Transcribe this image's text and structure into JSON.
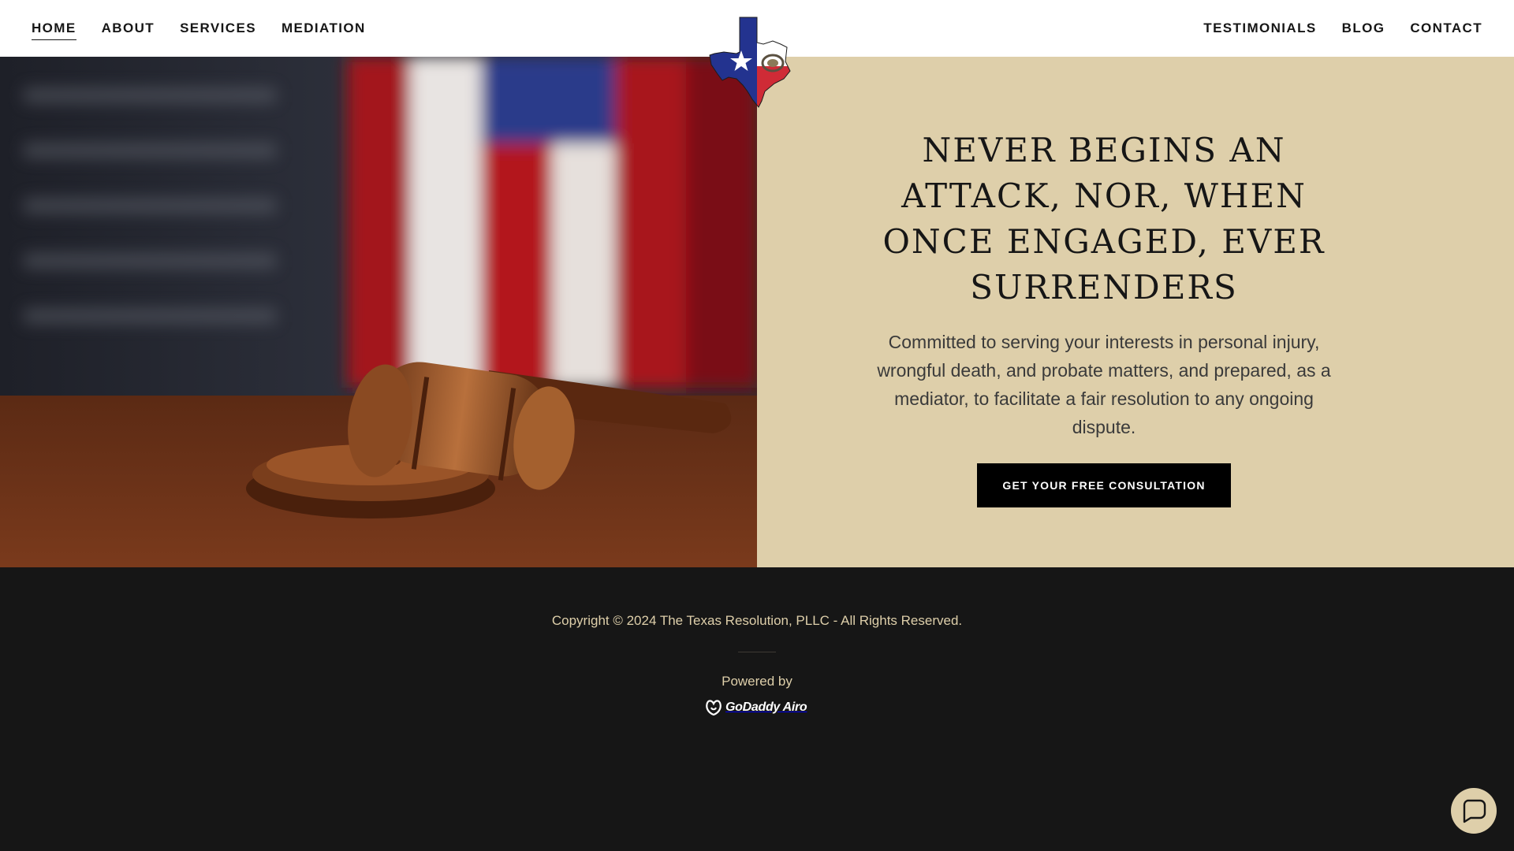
{
  "nav": {
    "left": [
      {
        "label": "HOME",
        "active": true
      },
      {
        "label": "ABOUT"
      },
      {
        "label": "SERVICES"
      },
      {
        "label": "MEDIATION"
      }
    ],
    "right": [
      {
        "label": "TESTIMONIALS"
      },
      {
        "label": "BLOG"
      },
      {
        "label": "CONTACT"
      }
    ]
  },
  "logo": {
    "icon": "texas-flag-map-logo"
  },
  "hero": {
    "image_icon": "gavel-and-flag-photo",
    "headline": "Never begins an attack, nor, when once engaged, ever surrenders",
    "subtext": "Committed to serving your interests in personal injury, wrongful death, and probate matters, and prepared, as a mediator, to facilitate a fair resolution to any ongoing dispute.",
    "cta_label": "GET YOUR FREE CONSULTATION"
  },
  "footer": {
    "copyright": "Copyright © 2024 The Texas Resolution, PLLC - All Rights Reserved.",
    "powered_by": "Powered by",
    "brand": "GoDaddy Airo"
  },
  "chat": {
    "icon": "chat-bubble-icon"
  },
  "colors": {
    "accent": "#decfaa",
    "dark": "#161616",
    "cta": "#000000"
  }
}
